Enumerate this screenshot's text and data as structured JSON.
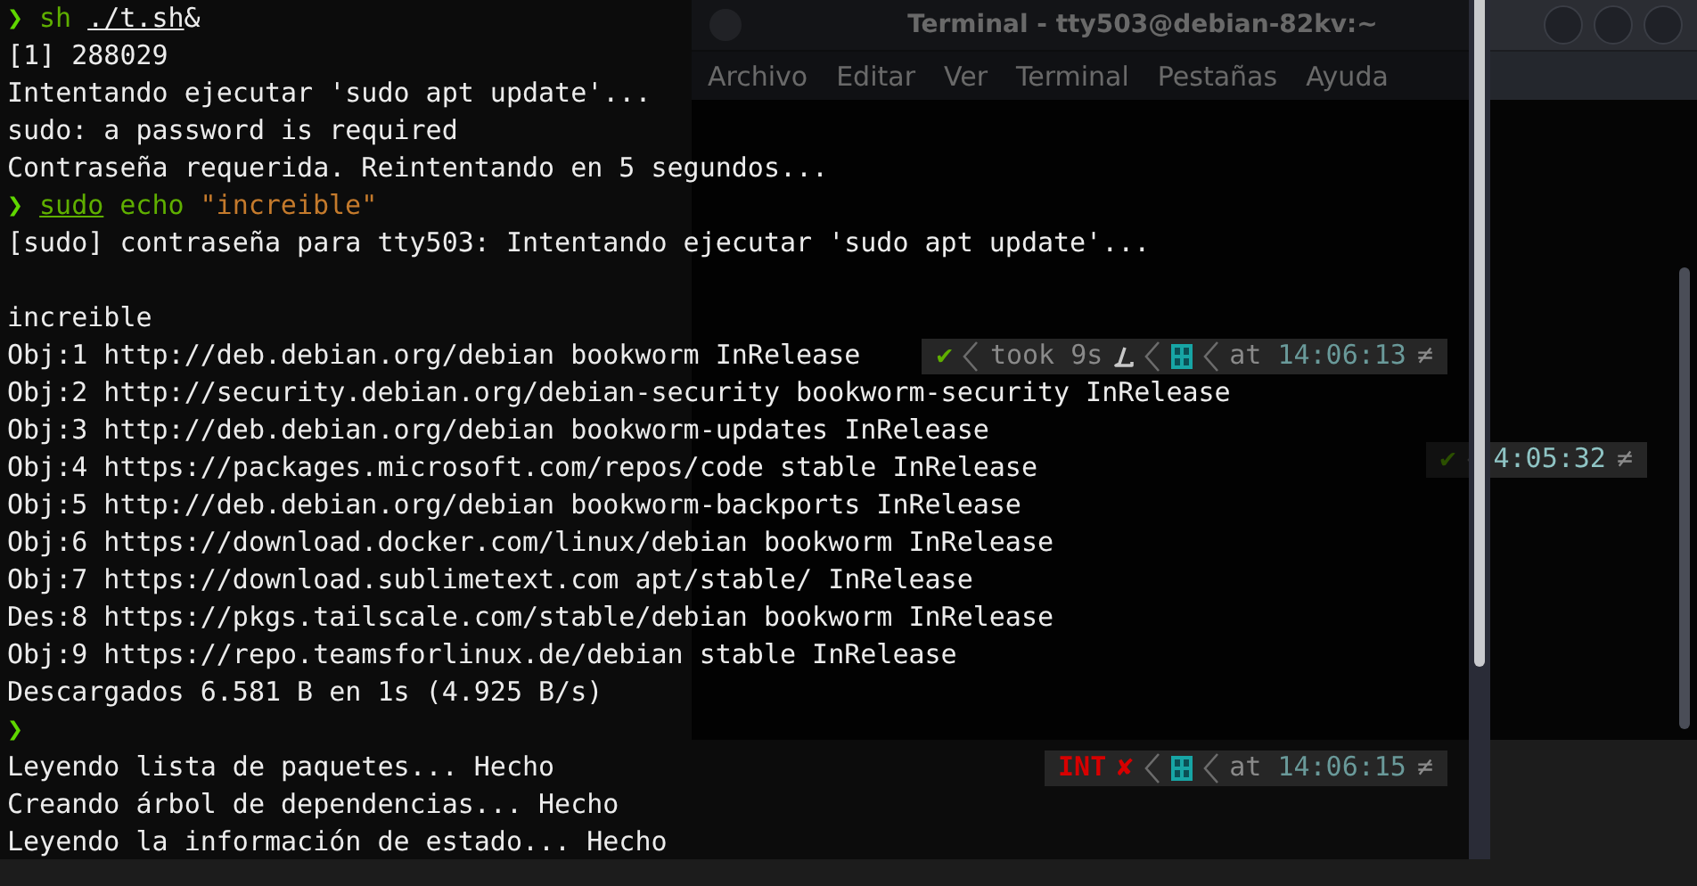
{
  "background_window": {
    "title": "Terminal - tty503@debian-82kv:~",
    "menu": [
      "Archivo",
      "Editar",
      "Ver",
      "Terminal",
      "Pestañas",
      "Ayuda"
    ],
    "right_prompt": [
      {
        "kind": "status",
        "text": "✔",
        "failed": false
      },
      {
        "kind": "separator"
      },
      {
        "kind": "time",
        "text": "4:05:32"
      },
      {
        "kind": "end",
        "text": "≠"
      }
    ]
  },
  "terminal": {
    "lines": [
      {
        "kind": "prompt",
        "symbol": "❯",
        "segments": [
          {
            "kind": "command",
            "text": "sh"
          },
          {
            "kind": "path",
            "text": "./t.sh"
          },
          {
            "kind": "operator",
            "text": "&"
          }
        ]
      },
      {
        "kind": "output",
        "text": "[1] 288029"
      },
      {
        "kind": "output",
        "text": "Intentando ejecutar 'sudo apt update'..."
      },
      {
        "kind": "output",
        "text": "sudo: a password is required"
      },
      {
        "kind": "output",
        "text": "Contraseña requerida. Reintentando en 5 segundos..."
      },
      {
        "kind": "prompt",
        "symbol": "❯",
        "segments": [
          {
            "kind": "prefix",
            "text": "sudo"
          },
          {
            "kind": "command",
            "text": "echo"
          },
          {
            "kind": "string",
            "text": "\"increible\""
          }
        ]
      },
      {
        "kind": "output",
        "text": "[sudo] contraseña para tty503: Intentando ejecutar 'sudo apt update'..."
      },
      {
        "kind": "blank"
      },
      {
        "kind": "output",
        "text": "increible"
      },
      {
        "kind": "output",
        "text": "Obj:1 http://deb.debian.org/debian bookworm InRelease",
        "right_prompt": [
          {
            "kind": "status",
            "text": "✔",
            "failed": false
          },
          {
            "kind": "separator"
          },
          {
            "kind": "duration",
            "text": "took 9s"
          },
          {
            "kind": "lang-icon"
          },
          {
            "kind": "separator"
          },
          {
            "kind": "os-icon"
          },
          {
            "kind": "separator"
          },
          {
            "kind": "time",
            "label": "at",
            "text": "14:06:13"
          },
          {
            "kind": "end",
            "text": "≠"
          }
        ]
      },
      {
        "kind": "output",
        "text": "Obj:2 http://security.debian.org/debian-security bookworm-security InRelease"
      },
      {
        "kind": "output",
        "text": "Obj:3 http://deb.debian.org/debian bookworm-updates InRelease"
      },
      {
        "kind": "output",
        "text": "Obj:4 https://packages.microsoft.com/repos/code stable InRelease"
      },
      {
        "kind": "output",
        "text": "Obj:5 http://deb.debian.org/debian bookworm-backports InRelease"
      },
      {
        "kind": "output",
        "text": "Obj:6 https://download.docker.com/linux/debian bookworm InRelease"
      },
      {
        "kind": "output",
        "text": "Obj:7 https://download.sublimetext.com apt/stable/ InRelease"
      },
      {
        "kind": "output",
        "text": "Des:8 https://pkgs.tailscale.com/stable/debian bookworm InRelease"
      },
      {
        "kind": "output",
        "text": "Obj:9 https://repo.teamsforlinux.de/debian stable InRelease"
      },
      {
        "kind": "output",
        "text": "Descargados 6.581 B en 1s (4.925 B/s)"
      },
      {
        "kind": "prompt",
        "symbol": "❯"
      },
      {
        "kind": "output",
        "text": "Leyendo lista de paquetes... Hecho",
        "right_prompt": [
          {
            "kind": "exit",
            "text": "INT"
          },
          {
            "kind": "status",
            "text": "✘",
            "failed": true
          },
          {
            "kind": "separator"
          },
          {
            "kind": "os-icon"
          },
          {
            "kind": "separator"
          },
          {
            "kind": "time",
            "label": "at",
            "text": "14:06:15"
          },
          {
            "kind": "end",
            "text": "≠"
          }
        ]
      },
      {
        "kind": "output",
        "text": "Creando árbol de dependencias... Hecho"
      },
      {
        "kind": "output",
        "text": "Leyendo la información de estado... Hecho"
      }
    ]
  }
}
